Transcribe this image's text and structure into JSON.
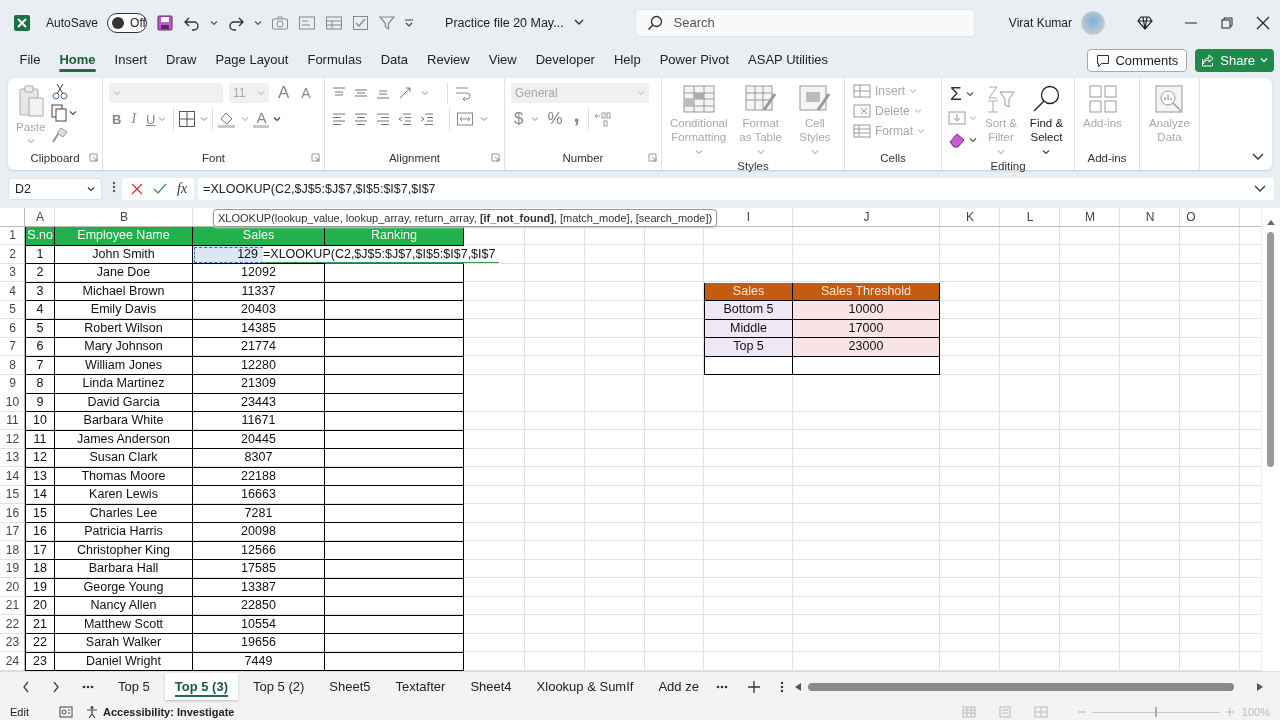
{
  "title_bar": {
    "autosave": {
      "label": "AutoSave",
      "on": false,
      "state": "Off"
    },
    "file_name": "Practice file 20 May...",
    "search_placeholder": "Search",
    "user_name": "Virat Kumar"
  },
  "menu_tabs": [
    {
      "label": "File",
      "selected": false
    },
    {
      "label": "Home",
      "selected": true
    },
    {
      "label": "Insert",
      "selected": false
    },
    {
      "label": "Draw",
      "selected": false
    },
    {
      "label": "Page Layout",
      "selected": false
    },
    {
      "label": "Formulas",
      "selected": false
    },
    {
      "label": "Data",
      "selected": false
    },
    {
      "label": "Review",
      "selected": false
    },
    {
      "label": "View",
      "selected": false
    },
    {
      "label": "Developer",
      "selected": false
    },
    {
      "label": "Help",
      "selected": false
    },
    {
      "label": "Power Pivot",
      "selected": false
    },
    {
      "label": "ASAP Utilities",
      "selected": false
    }
  ],
  "comments_button": "Comments",
  "share_button": "Share",
  "ribbon": {
    "groups": [
      {
        "kind": "clipboard",
        "label": "Clipboard",
        "buttons": [
          {
            "label": "Paste",
            "disabled": true
          }
        ]
      },
      {
        "kind": "font",
        "label": "Font",
        "font_size": "11",
        "buttons": [
          {
            "label": "A"
          },
          {
            "label": "A"
          },
          {
            "label": "B"
          },
          {
            "label": "I"
          },
          {
            "label": "U"
          },
          {
            "label": "A"
          }
        ]
      },
      {
        "kind": "alignment",
        "label": "Alignment"
      },
      {
        "kind": "number",
        "label": "Number",
        "format": "General",
        "buttons": [
          {
            "label": "$"
          },
          {
            "label": "%"
          },
          {
            "label": ","
          }
        ]
      },
      {
        "kind": "styles",
        "label": "Styles",
        "buttons": [
          {
            "label": "Conditional Formatting",
            "disabled": true
          },
          {
            "label": "Format as Table",
            "disabled": true
          },
          {
            "label": "Cell Styles",
            "disabled": true
          }
        ]
      },
      {
        "kind": "cells",
        "label": "Cells",
        "buttons": [
          {
            "label": "Insert",
            "disabled": true
          },
          {
            "label": "Delete",
            "disabled": true
          },
          {
            "label": "Format",
            "disabled": true
          }
        ]
      },
      {
        "kind": "editing",
        "label": "Editing",
        "sum": "Σ",
        "buttons": [
          {
            "label": "Sort & Filter",
            "disabled": true
          },
          {
            "label": "Find & Select",
            "disabled": false
          }
        ]
      },
      {
        "kind": "addins",
        "label": "Add-ins",
        "buttons": [
          {
            "label": "Add-ins",
            "disabled": true
          }
        ]
      },
      {
        "kind": "analysis",
        "buttons": [
          {
            "label": "Analyze Data",
            "disabled": true
          }
        ]
      }
    ]
  },
  "formula_bar": {
    "name_box": "D2",
    "fx": "fx",
    "formula": "=XLOOKUP(C2,$J$5:$J$7,$I$5:$I$7,$I$7"
  },
  "function_tooltip": "XLOOKUP(lookup_value, lookup_array, return_array, **[if_not_found]**, [match_mode], [search_mode])",
  "sheet": {
    "column_headers": [
      "A",
      "B",
      "I",
      "J",
      "K",
      "L",
      "M",
      "N",
      "O"
    ],
    "row_numbers": [
      "1",
      "2",
      "3",
      "4",
      "5",
      "6",
      "7",
      "8",
      "9",
      "10",
      "11",
      "12",
      "13",
      "14",
      "15",
      "16",
      "17",
      "18",
      "19",
      "20",
      "21",
      "22",
      "23",
      "24"
    ],
    "employee_table": {
      "columns": [
        "S.no",
        "Employee Name",
        "Sales",
        "Ranking"
      ],
      "rows": [
        {
          "sno": "1",
          "name": "John Smith",
          "sales": "129"
        },
        {
          "sno": "2",
          "name": "Jane Doe",
          "sales": "12092"
        },
        {
          "sno": "3",
          "name": "Michael Brown",
          "sales": "11337"
        },
        {
          "sno": "4",
          "name": "Emily Davis",
          "sales": "20403"
        },
        {
          "sno": "5",
          "name": "Robert Wilson",
          "sales": "14385"
        },
        {
          "sno": "6",
          "name": "Mary Johnson",
          "sales": "21774"
        },
        {
          "sno": "7",
          "name": "William Jones",
          "sales": "12280"
        },
        {
          "sno": "8",
          "name": "Linda Martinez",
          "sales": "21309"
        },
        {
          "sno": "9",
          "name": "David Garcia",
          "sales": "23443"
        },
        {
          "sno": "10",
          "name": "Barbara White",
          "sales": "11671"
        },
        {
          "sno": "11",
          "name": "James Anderson",
          "sales": "20445"
        },
        {
          "sno": "12",
          "name": "Susan Clark",
          "sales": "8307"
        },
        {
          "sno": "13",
          "name": "Thomas Moore",
          "sales": "22188"
        },
        {
          "sno": "14",
          "name": "Karen Lewis",
          "sales": "16663"
        },
        {
          "sno": "15",
          "name": "Charles Lee",
          "sales": "7281"
        },
        {
          "sno": "16",
          "name": "Patricia Harris",
          "sales": "20098"
        },
        {
          "sno": "17",
          "name": "Christopher King",
          "sales": "12566"
        },
        {
          "sno": "18",
          "name": "Barbara Hall",
          "sales": "17585"
        },
        {
          "sno": "19",
          "name": "George Young",
          "sales": "13387"
        },
        {
          "sno": "20",
          "name": "Nancy Allen",
          "sales": "22850"
        },
        {
          "sno": "21",
          "name": "Matthew Scott",
          "sales": "10554"
        },
        {
          "sno": "22",
          "name": "Sarah Walker",
          "sales": "19656"
        },
        {
          "sno": "23",
          "name": "Daniel Wright",
          "sales": "7449"
        }
      ]
    },
    "editing_cell": {
      "value": "=XLOOKUP(C2,$J$5:$J$7,$I$5:$I$7,$I$7"
    },
    "threshold_table": {
      "columns": [
        "Sales",
        "Sales Threshold"
      ],
      "rows": [
        {
          "label": "Bottom 5",
          "value": "10000"
        },
        {
          "label": "Middle",
          "value": "17000"
        },
        {
          "label": "Top 5",
          "value": "23000"
        }
      ]
    }
  },
  "sheet_tabs": [
    {
      "label": "Top 5",
      "selected": false
    },
    {
      "label": "Top 5 (3)",
      "selected": true
    },
    {
      "label": "Top 5 (2)",
      "selected": false
    },
    {
      "label": "Sheet5",
      "selected": false
    },
    {
      "label": "Textafter",
      "selected": false
    },
    {
      "label": "Sheet4",
      "selected": false
    },
    {
      "label": "Xlookup & SumIf",
      "selected": false
    },
    {
      "label": "Add ze",
      "selected": false
    }
  ],
  "status_bar": {
    "mode": "Edit",
    "accessibility": "Accessibility: Investigate",
    "zoom": {
      "level": 0.5,
      "reading": "100%"
    }
  }
}
